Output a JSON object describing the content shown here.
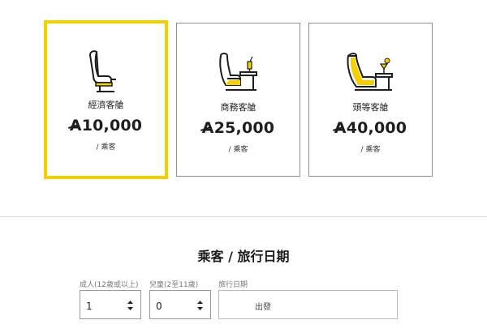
{
  "cabins": [
    {
      "name": "經濟客艙",
      "currency_symbol": "A",
      "amount": "10,000",
      "per_label": "/ 乘客",
      "selected": true,
      "icon": "economy-seat-icon"
    },
    {
      "name": "商務客艙",
      "currency_symbol": "A",
      "amount": "25,000",
      "per_label": "/ 乘客",
      "selected": false,
      "icon": "business-seat-icon"
    },
    {
      "name": "頭等客艙",
      "currency_symbol": "A",
      "amount": "40,000",
      "per_label": "/ 乘客",
      "selected": false,
      "icon": "first-class-seat-icon"
    }
  ],
  "colors": {
    "accent_yellow": "#f5d000",
    "border_gray": "#8f8f8f"
  },
  "passengers_section": {
    "title": "乘客 / 旅行日期",
    "adults": {
      "label": "成人(12歲或以上)",
      "value": "1"
    },
    "children": {
      "label": "兒童(2至11歲)",
      "value": "0"
    },
    "travel_date": {
      "label": "旅行日期",
      "value": "出發"
    }
  }
}
